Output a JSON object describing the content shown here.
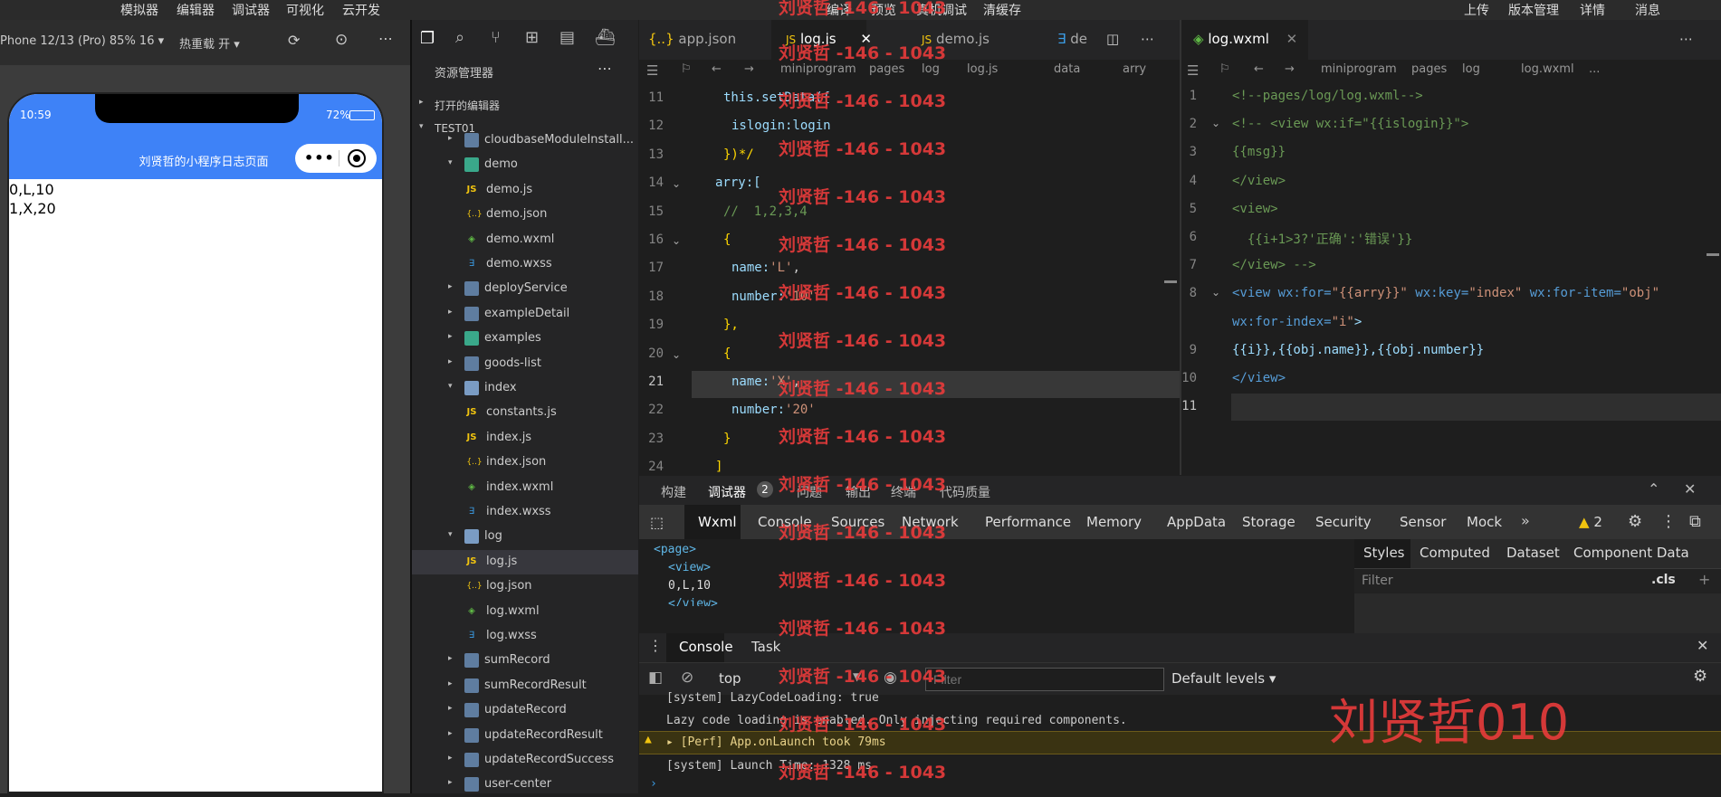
{
  "topbar": {
    "left_menu": [
      "模拟器",
      "编辑器",
      "调试器",
      "可视化",
      "云开发"
    ],
    "center_menu": [
      "编译",
      "预览",
      "真机调试",
      "清缓存"
    ],
    "right_menu": [
      "上传",
      "版本管理",
      "详情",
      "消息"
    ]
  },
  "simulator": {
    "device_label": "Phone 12/13 (Pro) 85% 16 ▾",
    "hot_reload": "热重载 开 ▾",
    "phone": {
      "time": "10:59",
      "battery": "72%",
      "title": "刘贤哲的小程序日志页面",
      "lines": [
        "0,L,10",
        "1,X,20"
      ]
    }
  },
  "explorer": {
    "title": "资源管理器",
    "open_editors": "打开的编辑器",
    "project": "TEST01",
    "items": [
      {
        "label": "cloudbaseModuleInstall...",
        "type": "folder",
        "depth": 1,
        "arrow": "▸"
      },
      {
        "label": "demo",
        "type": "folder-green",
        "depth": 1,
        "arrow": "▾"
      },
      {
        "label": "demo.js",
        "type": "js",
        "depth": 2,
        "arrow": ""
      },
      {
        "label": "demo.json",
        "type": "json",
        "depth": 2,
        "arrow": ""
      },
      {
        "label": "demo.wxml",
        "type": "wxml",
        "depth": 2,
        "arrow": ""
      },
      {
        "label": "demo.wxss",
        "type": "wxss",
        "depth": 2,
        "arrow": ""
      },
      {
        "label": "deployService",
        "type": "folder",
        "depth": 1,
        "arrow": "▸"
      },
      {
        "label": "exampleDetail",
        "type": "folder",
        "depth": 1,
        "arrow": "▸"
      },
      {
        "label": "examples",
        "type": "folder-green",
        "depth": 1,
        "arrow": "▸"
      },
      {
        "label": "goods-list",
        "type": "folder",
        "depth": 1,
        "arrow": "▸"
      },
      {
        "label": "index",
        "type": "folder-open",
        "depth": 1,
        "arrow": "▾"
      },
      {
        "label": "constants.js",
        "type": "js",
        "depth": 2,
        "arrow": ""
      },
      {
        "label": "index.js",
        "type": "js",
        "depth": 2,
        "arrow": ""
      },
      {
        "label": "index.json",
        "type": "json",
        "depth": 2,
        "arrow": ""
      },
      {
        "label": "index.wxml",
        "type": "wxml",
        "depth": 2,
        "arrow": ""
      },
      {
        "label": "index.wxss",
        "type": "wxss",
        "depth": 2,
        "arrow": ""
      },
      {
        "label": "log",
        "type": "folder-open",
        "depth": 1,
        "arrow": "▾"
      },
      {
        "label": "log.js",
        "type": "js",
        "depth": 2,
        "arrow": "",
        "selected": true
      },
      {
        "label": "log.json",
        "type": "json",
        "depth": 2,
        "arrow": ""
      },
      {
        "label": "log.wxml",
        "type": "wxml",
        "depth": 2,
        "arrow": ""
      },
      {
        "label": "log.wxss",
        "type": "wxss",
        "depth": 2,
        "arrow": ""
      },
      {
        "label": "sumRecord",
        "type": "folder",
        "depth": 1,
        "arrow": "▸"
      },
      {
        "label": "sumRecordResult",
        "type": "folder",
        "depth": 1,
        "arrow": "▸"
      },
      {
        "label": "updateRecord",
        "type": "folder",
        "depth": 1,
        "arrow": "▸"
      },
      {
        "label": "updateRecordResult",
        "type": "folder",
        "depth": 1,
        "arrow": "▸"
      },
      {
        "label": "updateRecordSuccess",
        "type": "folder",
        "depth": 1,
        "arrow": "▸"
      },
      {
        "label": "user-center",
        "type": "folder",
        "depth": 1,
        "arrow": "▸"
      }
    ]
  },
  "editor_left": {
    "tabs": [
      "app.json",
      "log.js",
      "demo.js",
      "de"
    ],
    "breadcrumb": [
      "miniprogram",
      "pages",
      "log",
      "log.js",
      "data",
      "arry"
    ],
    "lines": [
      {
        "n": "11",
        "code": "this.setData({",
        "indent": 1
      },
      {
        "n": "12",
        "code": "islogin:login",
        "indent": 2
      },
      {
        "n": "13",
        "code": "})*/",
        "indent": 1
      },
      {
        "n": "14",
        "code": "arry:[",
        "indent": 0
      },
      {
        "n": "15",
        "code": "//  1,2,3,4",
        "indent": 1
      },
      {
        "n": "16",
        "code": "{",
        "indent": 1
      },
      {
        "n": "17",
        "code": "name:'L',",
        "indent": 2
      },
      {
        "n": "18",
        "code": "number:'10'",
        "indent": 2
      },
      {
        "n": "19",
        "code": "},",
        "indent": 1
      },
      {
        "n": "20",
        "code": "{",
        "indent": 1
      },
      {
        "n": "21",
        "code": "name:'X',",
        "indent": 2
      },
      {
        "n": "22",
        "code": "number:'20'",
        "indent": 2
      },
      {
        "n": "23",
        "code": "}",
        "indent": 1
      },
      {
        "n": "24",
        "code": "]",
        "indent": 0
      }
    ]
  },
  "editor_right": {
    "tab": "log.wxml",
    "breadcrumb": [
      "miniprogram",
      "pages",
      "log",
      "log.wxml",
      "..."
    ],
    "lines": [
      {
        "n": "1",
        "code": "<!--pages/log/log.wxml-->"
      },
      {
        "n": "2",
        "code": "<!-- <view wx:if=\"{{islogin}}\">"
      },
      {
        "n": "3",
        "code": "{{msg}}"
      },
      {
        "n": "4",
        "code": "</view>"
      },
      {
        "n": "5",
        "code": "<view>"
      },
      {
        "n": "6",
        "code": "  {{i+1>3?'正确':'错误'}}"
      },
      {
        "n": "7",
        "code": "</view> -->"
      },
      {
        "n": "8",
        "code": "<view wx:for=\"{{arry}}\" wx:key=\"index\" wx:for-item=\"obj\""
      },
      {
        "n": "",
        "code": "wx:for-index=\"i\">"
      },
      {
        "n": "9",
        "code": "{{i}},{{obj.name}},{{obj.number}}"
      },
      {
        "n": "10",
        "code": "</view>"
      },
      {
        "n": "11",
        "code": ""
      }
    ]
  },
  "bottom": {
    "tabs": [
      "构建",
      "调试器",
      "问题",
      "输出",
      "终端",
      "代码质量"
    ],
    "debugger_badge": "2",
    "devtools_tabs": [
      "Wxml",
      "Console",
      "Sources",
      "Network",
      "Performance",
      "Memory",
      "AppData",
      "Storage",
      "Security",
      "Sensor",
      "Mock"
    ],
    "warn_count": "2",
    "wxml_tree": [
      "<page>",
      "<view>",
      "0,L,10",
      "</view>"
    ],
    "styles_tabs": [
      "Styles",
      "Computed",
      "Dataset",
      "Component Data"
    ],
    "styles_filter": "Filter",
    "styles_cls": ".cls",
    "console_tabs": [
      "Console",
      "Task"
    ],
    "context": "top",
    "filter_placeholder": "Filter",
    "levels": "Default levels ▾",
    "console_lines": [
      "[system] LazyCodeLoading: true",
      "Lazy code loading is enabled. Only injecting required components.",
      "▸ [Perf] App.onLaunch took 79ms",
      "[system] Launch Time: 1328 ms"
    ]
  },
  "watermark": {
    "small": "刘贤哲 -146 - 1043",
    "big": "刘贤哲010"
  },
  "colors": {
    "accent": "#3e82f7",
    "watermark": "#e83b3b"
  }
}
